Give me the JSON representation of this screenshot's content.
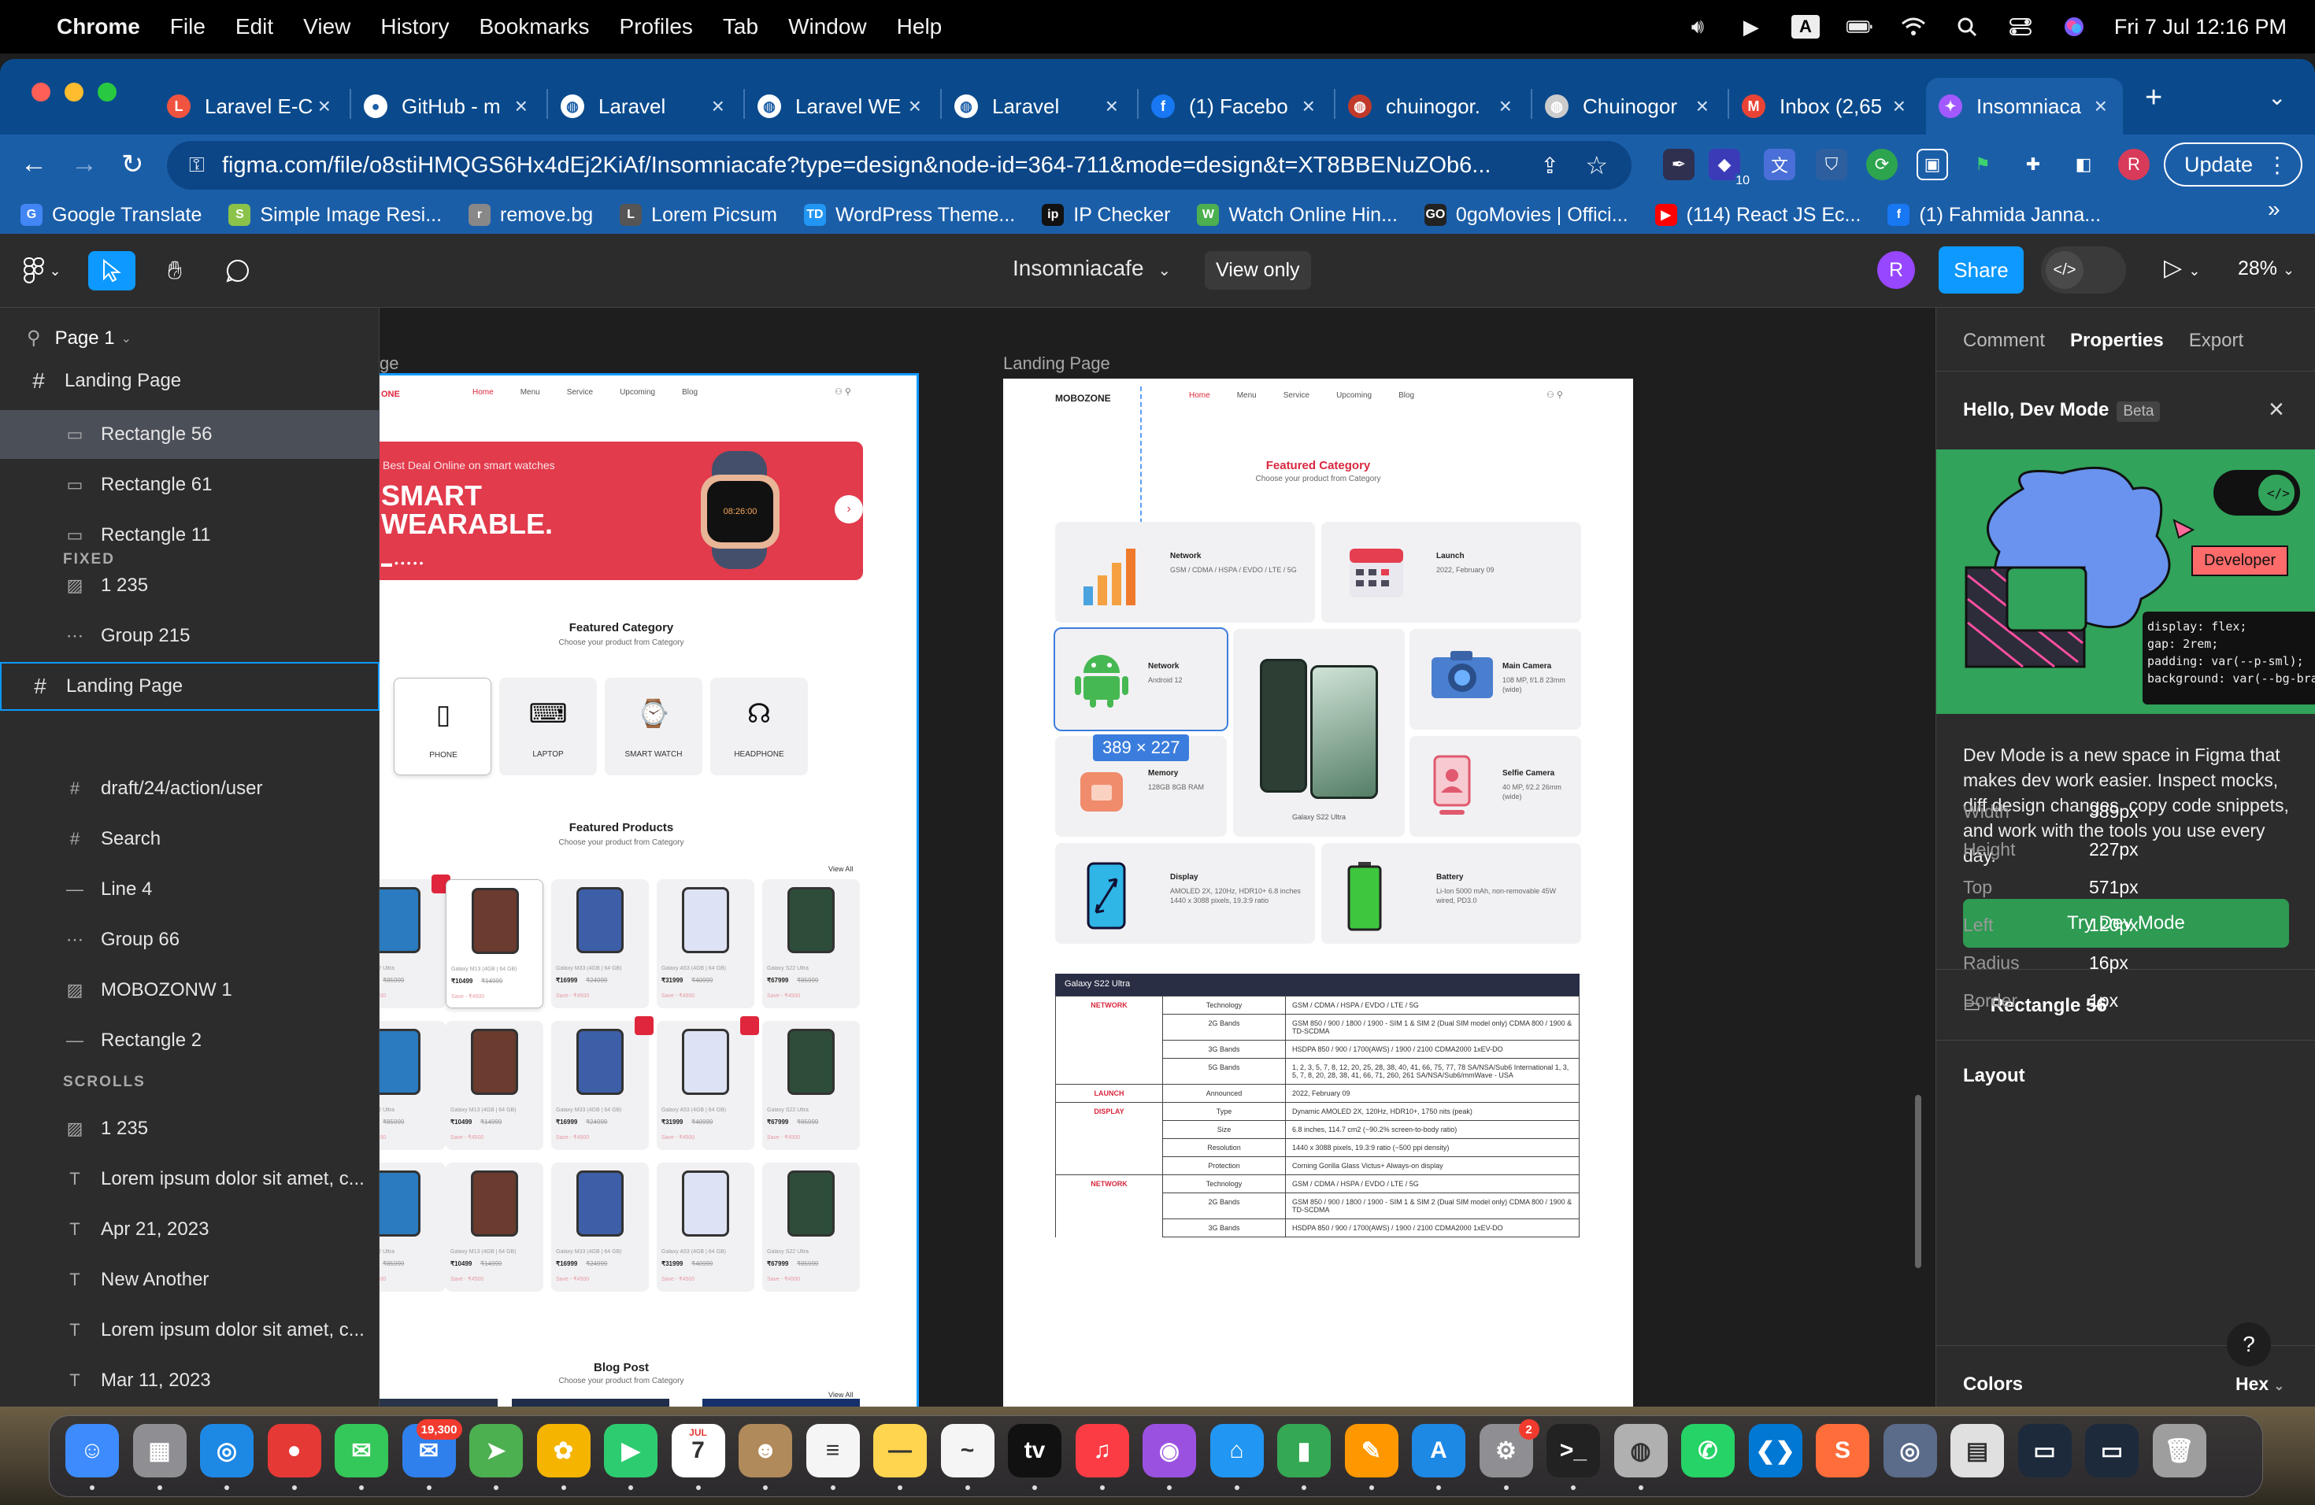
{
  "menubar": {
    "app": "Chrome",
    "items": [
      "File",
      "Edit",
      "View",
      "History",
      "Bookmarks",
      "Profiles",
      "Tab",
      "Window",
      "Help"
    ],
    "input_badge": "A",
    "clock": "Fri 7 Jul  12:16 PM"
  },
  "tabs": [
    {
      "title": "Laravel E-C",
      "icon": "laravel-icon",
      "color": "#f05340"
    },
    {
      "title": "GitHub - m",
      "icon": "github-icon",
      "color": "#ffffff"
    },
    {
      "title": "Laravel",
      "icon": "globe-icon",
      "color": "#ffffff"
    },
    {
      "title": "Laravel WE",
      "icon": "globe-icon",
      "color": "#ffffff"
    },
    {
      "title": "Laravel",
      "icon": "globe-icon",
      "color": "#ffffff"
    },
    {
      "title": "(1) Facebo",
      "icon": "facebook-icon",
      "color": "#1877f2"
    },
    {
      "title": "chuinogor.",
      "icon": "avatar-icon",
      "color": "#c0392b"
    },
    {
      "title": "Chuinogor",
      "icon": "bike-icon",
      "color": "#cccccc"
    },
    {
      "title": "Inbox (2,65",
      "icon": "gmail-icon",
      "color": "#ea4335"
    },
    {
      "title": "Insomniaca",
      "icon": "figma-icon",
      "color": "#a259ff",
      "active": true
    }
  ],
  "url": "figma.com/file/o8stiHMQGS6Hx4dEj2KiAf/Insomniacafe?type=design&node-id=364-711&mode=design&t=XT8BBENuZOb6...",
  "update_label": "Update",
  "profile_initial": "R",
  "ext_badge": "10",
  "bookmarks": [
    {
      "label": "Google Translate",
      "color": "#4285f4",
      "glyph": "G"
    },
    {
      "label": "Simple Image Resi...",
      "color": "#8bc34a",
      "glyph": "S"
    },
    {
      "label": "remove.bg",
      "color": "#888888",
      "glyph": "r"
    },
    {
      "label": "Lorem Picsum",
      "color": "#555555",
      "glyph": "L"
    },
    {
      "label": "WordPress Theme...",
      "color": "#2196f3",
      "glyph": "TD"
    },
    {
      "label": "IP Checker",
      "color": "#111111",
      "glyph": "ip"
    },
    {
      "label": "Watch Online Hin...",
      "color": "#4caf50",
      "glyph": "W"
    },
    {
      "label": "0goMovies | Offici...",
      "color": "#222222",
      "glyph": "GO"
    },
    {
      "label": "(114) React JS Ec...",
      "color": "#ff0000",
      "glyph": "▶"
    },
    {
      "label": "(1) Fahmida Janna...",
      "color": "#1877f2",
      "glyph": "f"
    }
  ],
  "figma": {
    "file_name": "Insomniacafe",
    "view_only": "View only",
    "user_initial": "R",
    "share": "Share",
    "zoom": "28%"
  },
  "layers": {
    "page": "Page 1",
    "items": [
      {
        "label": "Landing Page",
        "icon": "frame",
        "indent": 0
      },
      {
        "label": "Rectangle 56",
        "icon": "rect",
        "indent": 1,
        "selected": true
      },
      {
        "label": "Rectangle 61",
        "icon": "rect",
        "indent": 1
      },
      {
        "label": "Rectangle 11",
        "icon": "rect",
        "indent": 1
      },
      {
        "label": "1 235",
        "icon": "image",
        "indent": 1
      },
      {
        "label": "Group 215",
        "icon": "group",
        "indent": 1
      },
      {
        "label": "Landing Page",
        "icon": "frame",
        "indent": 0,
        "framesel": true
      }
    ],
    "fixed_label": "FIXED",
    "fixed": [
      {
        "label": "draft/24/action/user",
        "icon": "grid"
      },
      {
        "label": "Search",
        "icon": "grid"
      },
      {
        "label": "Line 4",
        "icon": "line"
      },
      {
        "label": "Group 66",
        "icon": "group"
      },
      {
        "label": "MOBOZONW 1",
        "icon": "image"
      },
      {
        "label": "Rectangle 2",
        "icon": "line"
      }
    ],
    "scrolls_label": "SCROLLS",
    "scrolls": [
      {
        "label": "1 235",
        "icon": "image"
      },
      {
        "label": "Lorem ipsum dolor sit amet, c...",
        "icon": "text"
      },
      {
        "label": "Apr 21, 2023",
        "icon": "text"
      },
      {
        "label": "New Another",
        "icon": "text"
      },
      {
        "label": "Lorem ipsum dolor sit amet, c...",
        "icon": "text"
      },
      {
        "label": "Mar 11, 2023",
        "icon": "text"
      }
    ]
  },
  "canvas": {
    "frame1_label": "ge",
    "frame2_label": "Landing Page",
    "nav_items": [
      "Home",
      "Menu",
      "Service",
      "Upcoming",
      "Blog"
    ],
    "logo": "MOBOZONE",
    "logo_partial": "ONE",
    "hero": {
      "kicker": "Best Deal Online on smart watches",
      "line1": "SMART",
      "line2": "WEARABLE.",
      "watch_time": "08:26:00"
    },
    "featured_category": {
      "title": "Featured Category",
      "sub": "Choose your product from Category",
      "items": [
        "PHONE",
        "LAPTOP",
        "SMART WATCH",
        "HEADPHONE"
      ]
    },
    "featured_products": {
      "title": "Featured Products",
      "sub": "Choose your product from Category",
      "view_all": "View All"
    },
    "blog": {
      "title": "Blog Post",
      "sub": "Choose your product from Category",
      "view_all": "View All"
    },
    "product_prices": [
      "₹10499",
      "₹16999",
      "₹31999",
      "₹67999"
    ],
    "product_old": [
      "₹14999",
      "₹24999",
      "₹40999",
      "₹85999"
    ],
    "product_names": [
      "Galaxy M13 (4GB | 64 GB)",
      "Galaxy M33 (4GB | 64 GB)",
      "Galaxy A53 (4GB | 64 GB)",
      "Galaxy S22 Ultra"
    ],
    "product_save": "Save - ₹4500",
    "f2": {
      "title": "Featured Category",
      "sub": "Choose your product from Category",
      "cards": [
        {
          "title": "Network",
          "desc": "GSM / CDMA / HSPA / EVDO / LTE / 5G"
        },
        {
          "title": "Launch",
          "desc": "2022, February 09"
        },
        {
          "title": "Network",
          "desc": "Android 12"
        },
        {
          "title": "Main Camera",
          "desc": "108 MP, f/1.8 23mm (wide)"
        },
        {
          "title": "Memory",
          "desc": "128GB 8GB RAM"
        },
        {
          "title": "Selfie Camera",
          "desc": "40 MP, f/2.2 26mm (wide)"
        },
        {
          "title": "Display",
          "desc": "AMOLED 2X, 120Hz, HDR10+ 6.8 inches 1440 x 3088 pixels, 19.3:9 ratio"
        },
        {
          "title": "Battery",
          "desc": "Li-Ion 5000 mAh, non-removable 45W wired, PD3.0"
        }
      ],
      "phone_caption": "Galaxy S22 Ultra",
      "dimension_badge": "389 × 227",
      "table_title": "Galaxy S22 Ultra",
      "table": [
        [
          "NETWORK",
          "Technology",
          "GSM / CDMA / HSPA / EVDO / LTE / 5G"
        ],
        [
          "",
          "2G Bands",
          "GSM 850 / 900 / 1800 / 1900 - SIM 1 & SIM 2 (Dual SIM model only) CDMA 800 / 1900 & TD-SCDMA"
        ],
        [
          "",
          "3G Bands",
          "HSDPA 850 / 900 / 1700(AWS) / 1900 / 2100 CDMA2000 1xEV-DO"
        ],
        [
          "",
          "5G Bands",
          "1, 2, 3, 5, 7, 8, 12, 20, 25, 28, 38, 40, 41, 66, 75, 77, 78 SA/NSA/Sub6 International 1, 3, 5, 7, 8, 20, 28, 38, 41, 66, 71, 260, 261 SA/NSA/Sub6/mmWave - USA"
        ],
        [
          "LAUNCH",
          "Announced",
          "2022, February 09"
        ],
        [
          "DISPLAY",
          "Type",
          "Dynamic AMOLED 2X, 120Hz, HDR10+, 1750 nits (peak)"
        ],
        [
          "",
          "Size",
          "6.8 inches, 114.7 cm2 (~90.2% screen-to-body ratio)"
        ],
        [
          "",
          "Resolution",
          "1440 x 3088 pixels, 19.3:9 ratio (~500 ppi density)"
        ],
        [
          "",
          "Protection",
          "Corning Gorilla Glass Victus+ Always-on display"
        ],
        [
          "NETWORK",
          "Technology",
          "GSM / CDMA / HSPA / EVDO / LTE / 5G"
        ],
        [
          "",
          "2G Bands",
          "GSM 850 / 900 / 1800 / 1900 - SIM 1 & SIM 2 (Dual SIM model only) CDMA 800 / 1900 & TD-SCDMA"
        ],
        [
          "",
          "3G Bands",
          "HSDPA 850 / 900 / 1700(AWS) / 1900 / 2100 CDMA2000 1xEV-DO"
        ]
      ]
    }
  },
  "rightpanel": {
    "tabs": [
      "Comment",
      "Properties",
      "Export"
    ],
    "hello": "Hello, Dev Mode",
    "beta": "Beta",
    "promo_badge": "Developer",
    "promo_code": [
      "display: flex;",
      "gap: 2rem;",
      "padding: var(--p-sml);",
      "background: var(--bg-bra"
    ],
    "promo_text": "Dev Mode is a new space in Figma that makes dev work easier. Inspect mocks, diff design changes, copy code snippets, and work with the tools you use every day.",
    "try_btn": "Try Dev Mode",
    "selection": "Rectangle 56",
    "layout_title": "Layout",
    "props": [
      {
        "k": "Width",
        "v": "389px"
      },
      {
        "k": "Height",
        "v": "227px"
      },
      {
        "k": "Top",
        "v": "571px"
      },
      {
        "k": "Left",
        "v": "120px"
      },
      {
        "k": "Radius",
        "v": "16px"
      },
      {
        "k": "Border",
        "v": "1px"
      }
    ],
    "colors_title": "Colors",
    "colors_format": "Hex",
    "help": "?"
  },
  "dock": {
    "apps": [
      {
        "name": "finder",
        "color": "#3d8bfd",
        "glyph": "☺"
      },
      {
        "name": "launchpad",
        "color": "#8e8e93",
        "glyph": "▦"
      },
      {
        "name": "safari",
        "color": "#1e88e5",
        "glyph": "◎"
      },
      {
        "name": "chrome",
        "color": "#e53935",
        "glyph": "●"
      },
      {
        "name": "messages",
        "color": "#34c759",
        "glyph": "✉"
      },
      {
        "name": "mail",
        "color": "#2f80ed",
        "glyph": "✉",
        "badge": "19,300"
      },
      {
        "name": "maps",
        "color": "#4caf50",
        "glyph": "➤"
      },
      {
        "name": "photos",
        "color": "#f4b400",
        "glyph": "✿"
      },
      {
        "name": "facetime",
        "color": "#2ecc71",
        "glyph": "▶"
      },
      {
        "name": "calendar",
        "color": "#ffffff",
        "glyph": "7",
        "top": "JUL"
      },
      {
        "name": "contacts",
        "color": "#b08a5a",
        "glyph": "☻"
      },
      {
        "name": "reminders",
        "color": "#f5f5f5",
        "glyph": "≡"
      },
      {
        "name": "notes",
        "color": "#ffd54f",
        "glyph": "—"
      },
      {
        "name": "freeform",
        "color": "#f5f5f5",
        "glyph": "~"
      },
      {
        "name": "tv",
        "color": "#111111",
        "glyph": "tv"
      },
      {
        "name": "music",
        "color": "#fc3c44",
        "glyph": "♫"
      },
      {
        "name": "podcasts",
        "color": "#9b51e0",
        "glyph": "◉"
      },
      {
        "name": "keynote",
        "color": "#2196f3",
        "glyph": "⌂"
      },
      {
        "name": "numbers",
        "color": "#34a853",
        "glyph": "▮"
      },
      {
        "name": "pages",
        "color": "#ff9800",
        "glyph": "✎"
      },
      {
        "name": "app-store",
        "color": "#1e88e5",
        "glyph": "A"
      },
      {
        "name": "system-settings",
        "color": "#8e8e93",
        "glyph": "⚙",
        "badge": "2"
      },
      {
        "name": "terminal",
        "color": "#222222",
        "glyph": ">_"
      },
      {
        "name": "disk-utility",
        "color": "#b0b0b0",
        "glyph": "◍"
      },
      {
        "name": "whatsapp",
        "color": "#25d366",
        "glyph": "✆"
      },
      {
        "name": "vscode",
        "color": "#0078d4",
        "glyph": "❮❯"
      },
      {
        "name": "sublime",
        "color": "#ff6d3a",
        "glyph": "S"
      },
      {
        "name": "proxyman",
        "color": "#5b6b8a",
        "glyph": "◎"
      },
      {
        "name": "preview",
        "color": "#e0e0e0",
        "glyph": "▤"
      },
      {
        "name": "window-1",
        "color": "#1c2a3c",
        "glyph": "▭"
      },
      {
        "name": "window-2",
        "color": "#1c2a3c",
        "glyph": "▭"
      },
      {
        "name": "trash",
        "color": "#9e9e9e",
        "glyph": "🗑"
      }
    ]
  }
}
